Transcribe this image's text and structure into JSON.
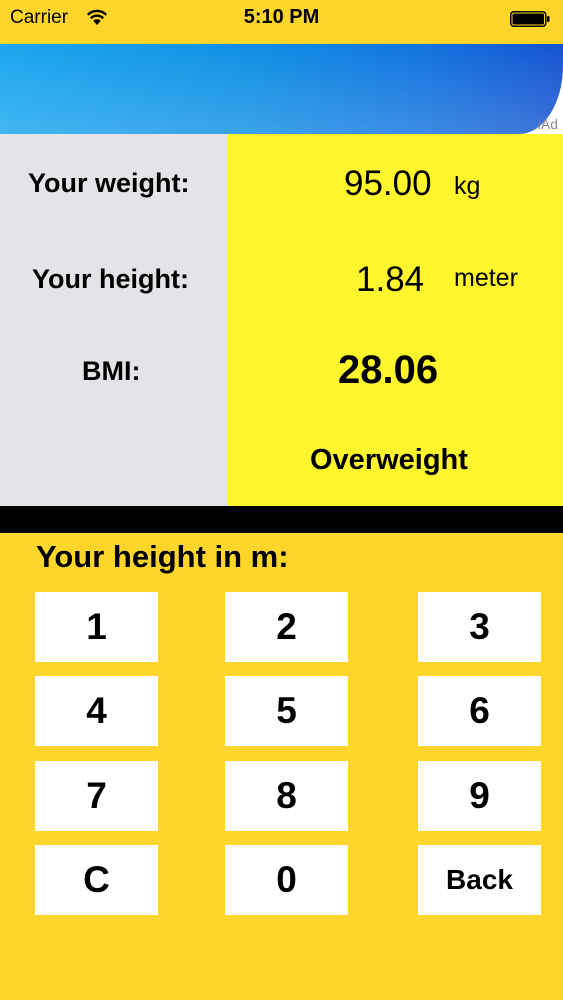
{
  "status_bar": {
    "carrier": "Carrier",
    "time": "5:10 PM",
    "icons": [
      "wifi-icon",
      "battery-icon"
    ]
  },
  "ad_banner": {
    "label": "iAd",
    "colors": [
      "#1aa6ee",
      "#1553d0"
    ]
  },
  "results": {
    "weight_label": "Your weight:",
    "weight_value": "95.00",
    "weight_unit": "kg",
    "height_label": "Your height:",
    "height_value": "1.84",
    "height_unit": "meter",
    "bmi_label": "BMI:",
    "bmi_value": "28.06",
    "bmi_category": "Overweight"
  },
  "keypad": {
    "title": "Your height in m:",
    "keys": [
      "1",
      "2",
      "3",
      "4",
      "5",
      "6",
      "7",
      "8",
      "9",
      "C",
      "0",
      "Back"
    ]
  },
  "colors": {
    "background": "#fed52a",
    "values_panel": "#fff52c",
    "labels_panel": "#e4e3e8",
    "divider": "#000000",
    "key_background": "#ffffff"
  }
}
